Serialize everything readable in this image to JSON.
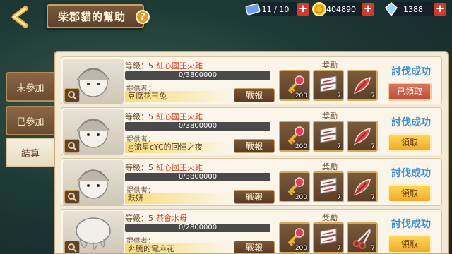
{
  "header": {
    "title": "柴郡貓的幫助",
    "help": "?"
  },
  "resources": [
    {
      "name": "stamina",
      "value": "11 / 10"
    },
    {
      "name": "gold",
      "value": "404890"
    },
    {
      "name": "gems",
      "value": "1388"
    }
  ],
  "tabs": [
    {
      "label": "未參加",
      "active": false
    },
    {
      "label": "已參加",
      "active": false
    },
    {
      "label": "結算",
      "active": true
    }
  ],
  "labels": {
    "level_prefix": "等級：",
    "provider": "提供者：",
    "report": "戰報",
    "reward": "獎勵"
  },
  "cards": [
    {
      "level": "5",
      "boss": "紅心國王火雞",
      "hp": "0/3800000",
      "provider": "豆腐花玉兔",
      "rewards": [
        {
          "icon": "key-icon",
          "count": "200"
        },
        {
          "icon": "scroll-icon",
          "count": "7"
        },
        {
          "icon": "feather-icon",
          "count": "7"
        }
      ],
      "status": "討伐成功",
      "button": "已領取",
      "claimed": true
    },
    {
      "level": "5",
      "boss": "紅心國王火雞",
      "hp": "0/3800000",
      "provider": "ஐ流星cYC的回憶之夜",
      "rewards": [
        {
          "icon": "key-icon",
          "count": "200"
        },
        {
          "icon": "scroll-icon",
          "count": "7"
        },
        {
          "icon": "feather-icon",
          "count": "7"
        }
      ],
      "status": "討伐成功",
      "button": "領取",
      "claimed": false
    },
    {
      "level": "5",
      "boss": "紅心國王火雞",
      "hp": "0/3800000",
      "provider": "麩妍",
      "rewards": [
        {
          "icon": "key-icon",
          "count": "200"
        },
        {
          "icon": "scroll-icon",
          "count": "7"
        },
        {
          "icon": "feather-icon",
          "count": "7"
        }
      ],
      "status": "討伐成功",
      "button": "領取",
      "claimed": false
    },
    {
      "level": "5",
      "boss": "茶會水母",
      "hp": "0/2800000",
      "provider": "奔騰的電麻花",
      "rewards": [
        {
          "icon": "key-icon",
          "count": "200"
        },
        {
          "icon": "scroll-icon",
          "count": "7"
        },
        {
          "icon": "scissors-icon",
          "count": "7"
        }
      ],
      "status": "討伐成功",
      "button": "領取",
      "claimed": false
    }
  ],
  "colors": {
    "success": "#3f8fd6",
    "boss_name": "#d2452f",
    "claim_done": "#c45f47",
    "claim_ready": "#f5c043"
  }
}
